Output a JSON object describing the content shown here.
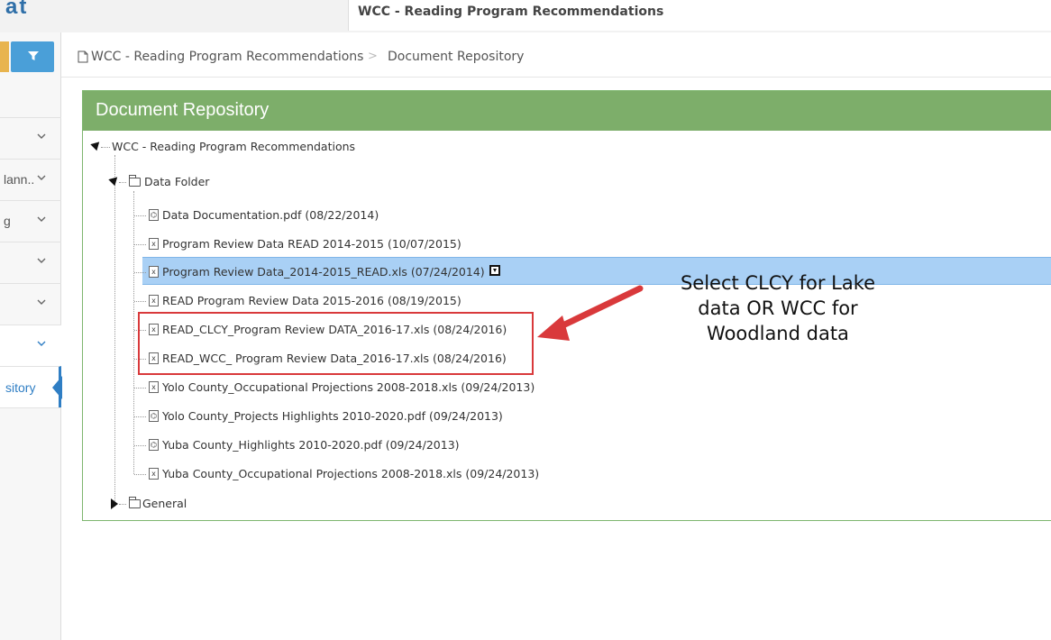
{
  "header": {
    "logo_text": "at",
    "window_title": "WCC - Reading Program Recommendations"
  },
  "sidebar": {
    "items": [
      {
        "label": ""
      },
      {
        "label": "lann.."
      },
      {
        "label": "g"
      },
      {
        "label": ""
      },
      {
        "label": ""
      },
      {
        "label": ""
      }
    ],
    "active_item": {
      "label": "sitory"
    }
  },
  "breadcrumb": {
    "home": "WCC - Reading Program Recommendations",
    "separator": ">",
    "current": "Document Repository"
  },
  "panel": {
    "title": "Document Repository"
  },
  "tree": {
    "root": "WCC - Reading Program Recommendations",
    "data_folder": {
      "label": "Data Folder",
      "files": [
        {
          "name": "Data Documentation.pdf (08/22/2014)",
          "type": "pdf"
        },
        {
          "name": "Program Review Data READ 2014-2015 (10/07/2015)",
          "type": "xls"
        },
        {
          "name": "Program Review Data_2014-2015_READ.xls (07/24/2014)",
          "type": "xls"
        },
        {
          "name": "READ Program Review Data 2015-2016 (08/19/2015)",
          "type": "xls"
        },
        {
          "name": "READ_CLCY_Program Review DATA_2016-17.xls (08/24/2016)",
          "type": "xls"
        },
        {
          "name": "READ_WCC_ Program Review Data_2016-17.xls (08/24/2016)",
          "type": "xls"
        },
        {
          "name": "Yolo County_Occupational Projections 2008-2018.xls (09/24/2013)",
          "type": "xls"
        },
        {
          "name": "Yolo County_Projects Highlights 2010-2020.pdf (09/24/2013)",
          "type": "pdf"
        },
        {
          "name": "Yuba County_Highlights 2010-2020.pdf (09/24/2013)",
          "type": "pdf"
        },
        {
          "name": "Yuba County_Occupational Projections 2008-2018.xls (09/24/2013)",
          "type": "xls"
        }
      ]
    },
    "general_folder": {
      "label": "General"
    }
  },
  "annotation": {
    "line1": "Select CLCY for Lake",
    "line2": "data OR WCC for",
    "line3": "Woodland data",
    "color": "#d9393b"
  },
  "colors": {
    "panel_header": "#7dae6a",
    "selected_row": "#a9d0f5",
    "accent_blue": "#2f7ec4"
  }
}
